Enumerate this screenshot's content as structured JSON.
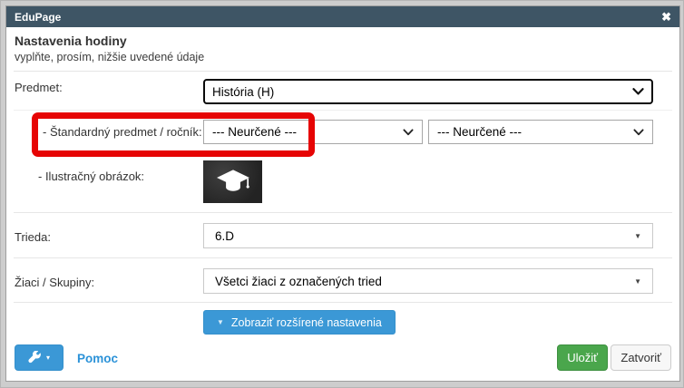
{
  "titlebar": {
    "title": "EduPage",
    "close_glyph": "✖"
  },
  "header": {
    "title": "Nastavenia hodiny",
    "subtitle": "vyplňte, prosím, nižšie uvedené údaje"
  },
  "form": {
    "subject": {
      "label": "Predmet:",
      "value": "História (H)"
    },
    "standard_subject": {
      "label": "- Štandardný predmet / ročník:",
      "subject_value": "--- Neurčené ---",
      "grade_value": "--- Neurčené ---"
    },
    "illustration": {
      "label": "- Ilustračný obrázok:",
      "image_name": "graduation-cap-chalkboard"
    },
    "class": {
      "label": "Trieda:",
      "value": "6.D"
    },
    "students": {
      "label": "Žiaci / Skupiny:",
      "value": "Všetci žiaci z označených tried"
    }
  },
  "actions": {
    "advanced_toggle": "Zobraziť rozšírené nastavenia",
    "help": "Pomoc",
    "save": "Uložiť",
    "close": "Zatvoriť"
  },
  "icons": {
    "triangle_down": "▼",
    "caret_down": "▾"
  },
  "annotation": {
    "type": "red-highlight-rectangle",
    "color": "#e60404",
    "highlights": "Štandardný predmet / ročník field"
  },
  "colors": {
    "titlebar_bg": "#3e5565",
    "accent_blue": "#3b98d6",
    "save_green": "#4aa64c",
    "link_blue": "#2b92d8"
  }
}
